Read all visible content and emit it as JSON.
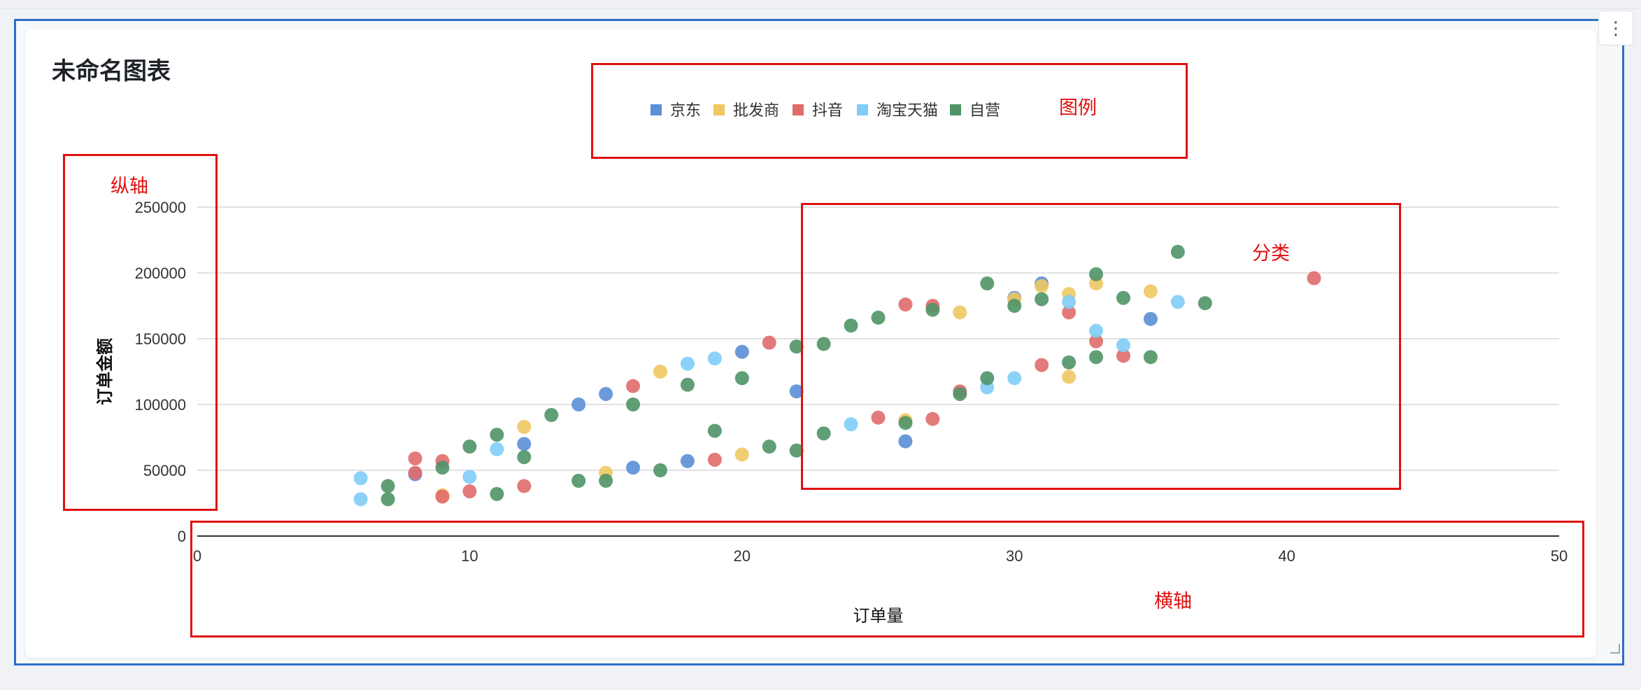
{
  "page": {
    "title": "未命名图表"
  },
  "menu": {
    "icon": "more-vertical-icon",
    "glyph": "⋮"
  },
  "annotations": {
    "legend": "图例",
    "y_axis": "纵轴",
    "category": "分类",
    "x_axis": "横轴"
  },
  "colors": {
    "京东": "#5b8fd6",
    "批发商": "#f0c862",
    "抖音": "#e06b6b",
    "淘宝天猫": "#7fcdf7",
    "自营": "#4f9467",
    "annotation": "#e01010",
    "frame": "#2b6fc7"
  },
  "chart_data": {
    "type": "scatter",
    "title": "",
    "xlabel": "订单量",
    "ylabel": "订单金额",
    "xlim": [
      0,
      50
    ],
    "ylim": [
      0,
      250000
    ],
    "x_ticks": [
      "0",
      "10",
      "20",
      "30",
      "40",
      "50"
    ],
    "y_ticks": [
      "0",
      "50000",
      "100000",
      "150000",
      "200000",
      "250000"
    ],
    "grid": true,
    "legend_position": "top-center",
    "series": [
      {
        "name": "京东",
        "points": [
          [
            14,
            100000
          ],
          [
            15,
            108000
          ],
          [
            16,
            52000
          ],
          [
            18,
            57000
          ],
          [
            20,
            140000
          ],
          [
            26,
            72000
          ],
          [
            30,
            181000
          ],
          [
            31,
            192000
          ],
          [
            35,
            165000
          ],
          [
            8,
            47000
          ],
          [
            12,
            70000
          ],
          [
            22,
            110000
          ]
        ]
      },
      {
        "name": "批发商",
        "points": [
          [
            9,
            31000
          ],
          [
            12,
            83000
          ],
          [
            15,
            48000
          ],
          [
            17,
            125000
          ],
          [
            20,
            62000
          ],
          [
            26,
            88000
          ],
          [
            28,
            170000
          ],
          [
            30,
            180000
          ],
          [
            31,
            190000
          ],
          [
            32,
            121000
          ],
          [
            32,
            184000
          ],
          [
            33,
            192000
          ],
          [
            35,
            186000
          ]
        ]
      },
      {
        "name": "抖音",
        "points": [
          [
            8,
            59000
          ],
          [
            8,
            48000
          ],
          [
            9,
            57000
          ],
          [
            9,
            30000
          ],
          [
            10,
            34000
          ],
          [
            12,
            38000
          ],
          [
            16,
            114000
          ],
          [
            19,
            58000
          ],
          [
            21,
            147000
          ],
          [
            25,
            90000
          ],
          [
            26,
            176000
          ],
          [
            27,
            175000
          ],
          [
            27,
            89000
          ],
          [
            28,
            110000
          ],
          [
            31,
            130000
          ],
          [
            32,
            170000
          ],
          [
            33,
            148000
          ],
          [
            34,
            137000
          ],
          [
            41,
            196000
          ]
        ]
      },
      {
        "name": "淘宝天猫",
        "points": [
          [
            6,
            44000
          ],
          [
            6,
            28000
          ],
          [
            10,
            45000
          ],
          [
            11,
            66000
          ],
          [
            18,
            131000
          ],
          [
            19,
            135000
          ],
          [
            29,
            113000
          ],
          [
            30,
            120000
          ],
          [
            32,
            178000
          ],
          [
            33,
            156000
          ],
          [
            34,
            145000
          ],
          [
            36,
            178000
          ],
          [
            24,
            85000
          ]
        ]
      },
      {
        "name": "自营",
        "points": [
          [
            7,
            38000
          ],
          [
            7,
            28000
          ],
          [
            9,
            52000
          ],
          [
            10,
            68000
          ],
          [
            11,
            77000
          ],
          [
            11,
            32000
          ],
          [
            12,
            60000
          ],
          [
            13,
            92000
          ],
          [
            14,
            42000
          ],
          [
            15,
            42000
          ],
          [
            16,
            100000
          ],
          [
            17,
            50000
          ],
          [
            18,
            115000
          ],
          [
            19,
            80000
          ],
          [
            20,
            120000
          ],
          [
            21,
            68000
          ],
          [
            22,
            65000
          ],
          [
            22,
            144000
          ],
          [
            23,
            78000
          ],
          [
            23,
            146000
          ],
          [
            24,
            160000
          ],
          [
            25,
            166000
          ],
          [
            26,
            86000
          ],
          [
            27,
            172000
          ],
          [
            28,
            108000
          ],
          [
            29,
            192000
          ],
          [
            29,
            120000
          ],
          [
            30,
            175000
          ],
          [
            31,
            180000
          ],
          [
            32,
            132000
          ],
          [
            33,
            199000
          ],
          [
            33,
            136000
          ],
          [
            34,
            181000
          ],
          [
            35,
            136000
          ],
          [
            36,
            216000
          ],
          [
            37,
            177000
          ]
        ]
      }
    ]
  }
}
